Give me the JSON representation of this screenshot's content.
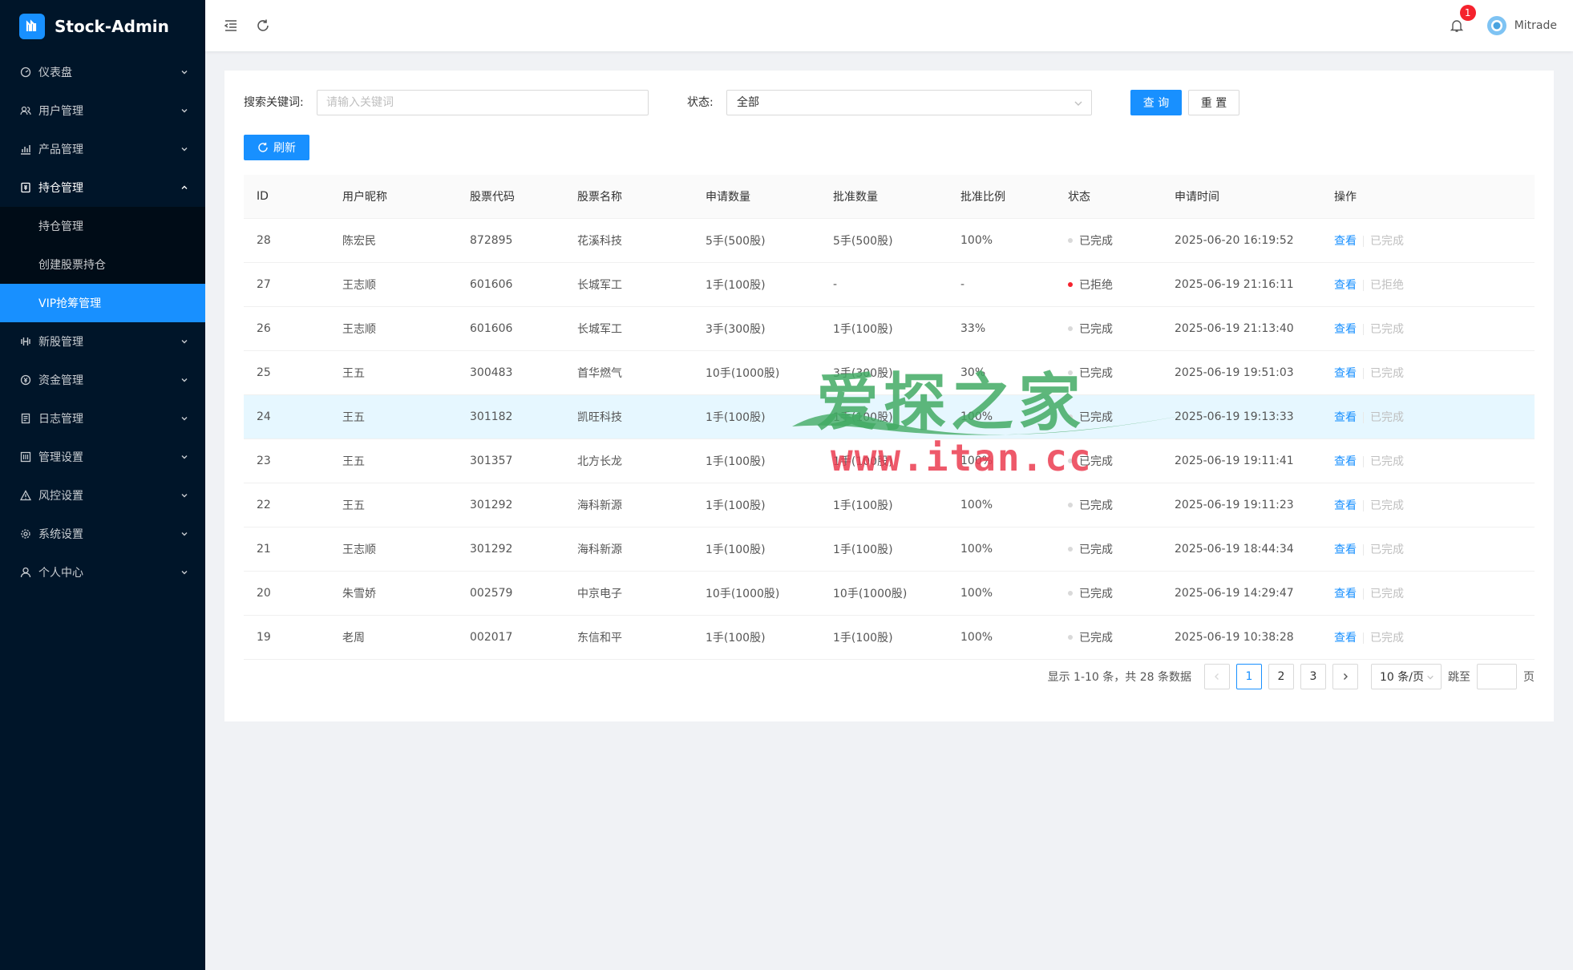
{
  "app": {
    "title": "Stock-Admin"
  },
  "sidebar": {
    "items": [
      {
        "label": "仪表盘",
        "icon": "dashboard-icon"
      },
      {
        "label": "用户管理",
        "icon": "user-group-icon"
      },
      {
        "label": "产品管理",
        "icon": "chart-icon"
      },
      {
        "label": "持仓管理",
        "icon": "holdings-icon",
        "open": true,
        "children": [
          {
            "label": "持仓管理"
          },
          {
            "label": "创建股票持仓"
          },
          {
            "label": "VIP抢筹管理",
            "active": true
          }
        ]
      },
      {
        "label": "新股管理",
        "icon": "ipo-icon"
      },
      {
        "label": "资金管理",
        "icon": "money-icon"
      },
      {
        "label": "日志管理",
        "icon": "log-icon"
      },
      {
        "label": "管理设置",
        "icon": "admin-settings-icon"
      },
      {
        "label": "风控设置",
        "icon": "warning-icon"
      },
      {
        "label": "系统设置",
        "icon": "gear-icon"
      },
      {
        "label": "个人中心",
        "icon": "person-icon"
      }
    ]
  },
  "header": {
    "notifications": "1",
    "username": "Mitrade"
  },
  "search": {
    "keyword_label": "搜索关键词:",
    "keyword_placeholder": "请输入关键词",
    "status_label": "状态:",
    "status_value": "全部",
    "query_label": "查 询",
    "reset_label": "重 置",
    "refresh_label": "刷新"
  },
  "table": {
    "columns": [
      "ID",
      "用户昵称",
      "股票代码",
      "股票名称",
      "申请数量",
      "批准数量",
      "批准比例",
      "状态",
      "申请时间",
      "操作"
    ],
    "view_label": "查看",
    "rows": [
      {
        "id": "28",
        "user": "陈宏民",
        "code": "872895",
        "name": "花溪科技",
        "req": "5手(500股)",
        "appr": "5手(500股)",
        "ratio": "100%",
        "status": "已完成",
        "status_color": "#d9d9d9",
        "time": "2025-06-20 16:19:52",
        "op": "已完成"
      },
      {
        "id": "27",
        "user": "王志顺",
        "code": "601606",
        "name": "长城军工",
        "req": "1手(100股)",
        "appr": "-",
        "ratio": "-",
        "status": "已拒绝",
        "status_color": "#f5222d",
        "time": "2025-06-19 21:16:11",
        "op": "已拒绝"
      },
      {
        "id": "26",
        "user": "王志顺",
        "code": "601606",
        "name": "长城军工",
        "req": "3手(300股)",
        "appr": "1手(100股)",
        "ratio": "33%",
        "status": "已完成",
        "status_color": "#d9d9d9",
        "time": "2025-06-19 21:13:40",
        "op": "已完成"
      },
      {
        "id": "25",
        "user": "王五",
        "code": "300483",
        "name": "首华燃气",
        "req": "10手(1000股)",
        "appr": "3手(300股)",
        "ratio": "30%",
        "status": "已完成",
        "status_color": "#d9d9d9",
        "time": "2025-06-19 19:51:03",
        "op": "已完成"
      },
      {
        "id": "24",
        "user": "王五",
        "code": "301182",
        "name": "凯旺科技",
        "req": "1手(100股)",
        "appr": "1手(100股)",
        "ratio": "100%",
        "status": "已完成",
        "status_color": "#d9d9d9",
        "time": "2025-06-19 19:13:33",
        "op": "已完成",
        "highlight": true
      },
      {
        "id": "23",
        "user": "王五",
        "code": "301357",
        "name": "北方长龙",
        "req": "1手(100股)",
        "appr": "1手(100股)",
        "ratio": "100%",
        "status": "已完成",
        "status_color": "#d9d9d9",
        "time": "2025-06-19 19:11:41",
        "op": "已完成"
      },
      {
        "id": "22",
        "user": "王五",
        "code": "301292",
        "name": "海科新源",
        "req": "1手(100股)",
        "appr": "1手(100股)",
        "ratio": "100%",
        "status": "已完成",
        "status_color": "#d9d9d9",
        "time": "2025-06-19 19:11:23",
        "op": "已完成"
      },
      {
        "id": "21",
        "user": "王志顺",
        "code": "301292",
        "name": "海科新源",
        "req": "1手(100股)",
        "appr": "1手(100股)",
        "ratio": "100%",
        "status": "已完成",
        "status_color": "#d9d9d9",
        "time": "2025-06-19 18:44:34",
        "op": "已完成"
      },
      {
        "id": "20",
        "user": "朱雪娇",
        "code": "002579",
        "name": "中京电子",
        "req": "10手(1000股)",
        "appr": "10手(1000股)",
        "ratio": "100%",
        "status": "已完成",
        "status_color": "#d9d9d9",
        "time": "2025-06-19 14:29:47",
        "op": "已完成"
      },
      {
        "id": "19",
        "user": "老周",
        "code": "002017",
        "name": "东信和平",
        "req": "1手(100股)",
        "appr": "1手(100股)",
        "ratio": "100%",
        "status": "已完成",
        "status_color": "#d9d9d9",
        "time": "2025-06-19 10:38:28",
        "op": "已完成"
      }
    ]
  },
  "pagination": {
    "total_text": "显示 1-10 条，共 28 条数据",
    "pages": [
      "1",
      "2",
      "3"
    ],
    "current": "1",
    "page_size": "10 条/页",
    "jump_label": "跳至",
    "page_suffix": "页"
  },
  "watermark": {
    "line1": "爱探之家",
    "line2": "www.itan.cc"
  },
  "colors": {
    "primary": "#1890ff",
    "sidebar_bg": "#001529",
    "danger": "#f5222d"
  }
}
